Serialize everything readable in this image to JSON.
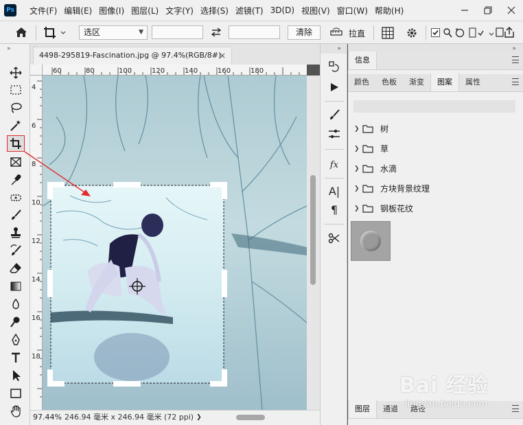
{
  "app": {
    "logo": "Ps"
  },
  "menu": [
    "文件(F)",
    "编辑(E)",
    "图像(I)",
    "图层(L)",
    "文字(Y)",
    "选择(S)",
    "滤镜(T)",
    "3D(D)",
    "视图(V)",
    "窗口(W)",
    "帮助(H)"
  ],
  "window_controls": [
    "minimize-icon",
    "restore-icon",
    "close-icon"
  ],
  "options": {
    "ratio_select": "选区",
    "width_value": "",
    "height_value": "",
    "clear_label": "清除",
    "straighten_label": "拉直"
  },
  "tools": [
    "move",
    "marquee",
    "lasso",
    "magic-wand",
    "crop",
    "frame",
    "eyedropper",
    "spot-heal",
    "brush",
    "stamp",
    "history-brush",
    "eraser",
    "gradient",
    "blur",
    "dodge",
    "pen",
    "type",
    "path-select",
    "rectangle",
    "hand"
  ],
  "document": {
    "tab_title": "4498-295819-Fascination.jpg @ 97.4%(RGB/8#)",
    "tab_close": "×",
    "ruler_top": [
      "60",
      "80",
      "100",
      "120",
      "140",
      "160",
      "180"
    ],
    "ruler_left": [
      "4",
      "6",
      "8",
      "10",
      "12",
      "14",
      "16",
      "18"
    ],
    "status_zoom": "97.44%",
    "status_info": "246.94 毫米 x 246.94 毫米 (72 ppi)",
    "status_arrow": "❯"
  },
  "panels": {
    "info_tab": "信息",
    "tabs": [
      "颜色",
      "色板",
      "渐变",
      "图案",
      "属性"
    ],
    "active_tab": "图案",
    "pattern_folders": [
      "树",
      "草",
      "水滴",
      "方块背景纹理",
      "钢板花纹"
    ],
    "lower_tabs": [
      "图层",
      "通道",
      "路径"
    ],
    "collapse": "»"
  },
  "watermark": {
    "logo": "Bai 经验",
    "url": "jingyan.baidu.com"
  },
  "colors": {
    "crop_highlight": "#e12b2b",
    "annotation_arrow": "#e12b2b",
    "ui_bg": "#f0f0f0",
    "photo_tint": "#b8d2d6"
  }
}
